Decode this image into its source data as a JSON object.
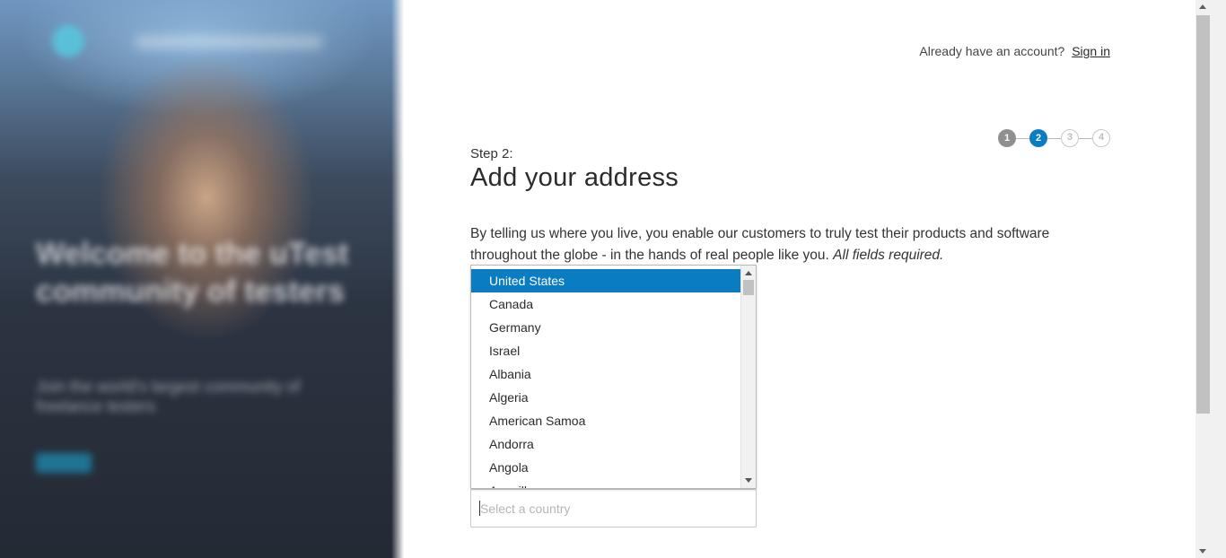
{
  "hero": {
    "headline": "Welcome to the uTest community of testers",
    "subline": "Join the world's largest community of freelance testers",
    "cta": "Learn"
  },
  "header": {
    "account_prompt": "Already have an account?",
    "sign_in_label": "Sign in"
  },
  "stepper": {
    "steps": [
      "1",
      "2",
      "3",
      "4"
    ],
    "current": 2
  },
  "form": {
    "step_label": "Step 2:",
    "title": "Add your address",
    "intro": "By telling us where you live, you enable our customers to truly test their products and software throughout the globe - in the hands of real people like you.",
    "intro_emphasis": "All fields required.",
    "country_placeholder": "Select a country"
  },
  "country_dropdown": {
    "selected": "United States",
    "options": [
      "United States",
      "Canada",
      "Germany",
      "Israel",
      "Albania",
      "Algeria",
      "American Samoa",
      "Andorra",
      "Angola",
      "Anguilla"
    ]
  },
  "colors": {
    "accent": "#0a7cc2",
    "step_done": "#8f8f8f",
    "step_todo_border": "#c8c8c8"
  }
}
